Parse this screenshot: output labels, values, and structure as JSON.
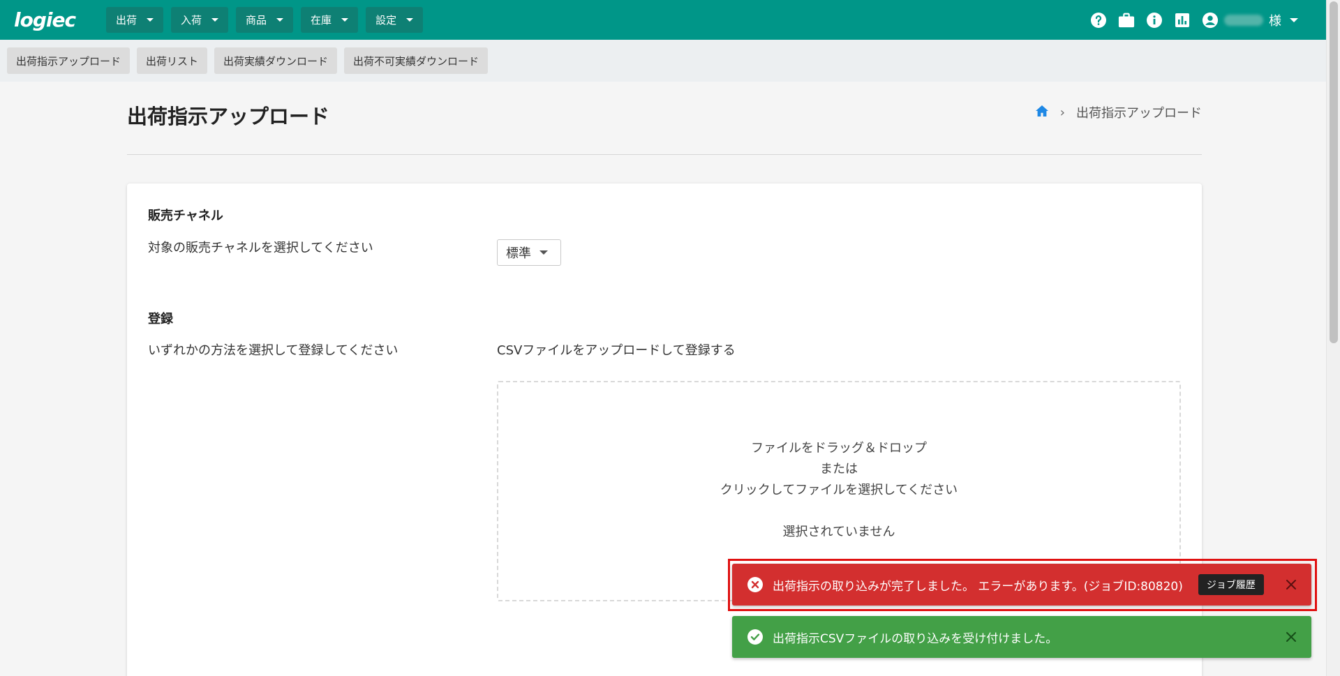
{
  "app": {
    "logo_text": "logiec"
  },
  "nav": {
    "menus": [
      "出荷",
      "入荷",
      "商品",
      "在庫",
      "設定"
    ],
    "user_suffix": "様"
  },
  "subnav": {
    "buttons": [
      "出荷指示アップロード",
      "出荷リスト",
      "出荷実績ダウンロード",
      "出荷不可実績ダウンロード"
    ]
  },
  "page": {
    "title": "出荷指示アップロード",
    "breadcrumb_current": "出荷指示アップロード"
  },
  "form": {
    "channel_section_title": "販売チャネル",
    "channel_label": "対象の販売チャネルを選択してください",
    "channel_selected": "標準",
    "register_section_title": "登録",
    "register_label": "いずれかの方法を選択して登録してください",
    "csv_method_label": "CSVファイルをアップロードして登録する",
    "dropzone": {
      "line1": "ファイルをドラッグ＆ドロップ",
      "line2": "または",
      "line3": "クリックしてファイルを選択してください",
      "status": "選択されていません"
    }
  },
  "toasts": {
    "error_message": "出荷指示の取り込みが完了しました。 エラーがあります。(ジョブID:80820)",
    "error_button": "ジョブ履歴",
    "success_message": "出荷指示CSVファイルの取り込みを受け付けました。"
  },
  "colors": {
    "primary": "#009688",
    "error": "#d32f2f",
    "success": "#43a047"
  }
}
